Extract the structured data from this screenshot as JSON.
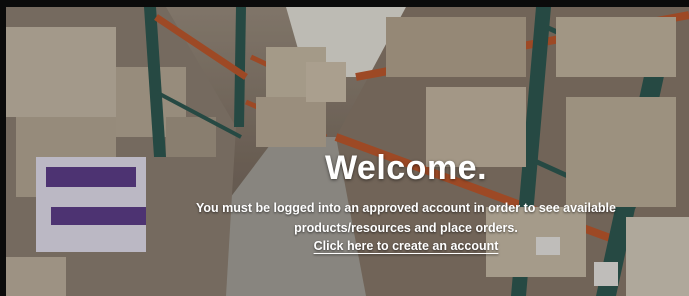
{
  "hero": {
    "heading": "Welcome.",
    "message_line1": "You must be logged into an approved account in order to see available",
    "message_line2": "products/resources and place orders.",
    "cta_label": "Click here to create an account",
    "background_image": "warehouse-shelves-photo"
  },
  "colors": {
    "text": "#ffffff",
    "shelf_orange": "#c0592e",
    "shelf_teal": "#2f5a52"
  }
}
